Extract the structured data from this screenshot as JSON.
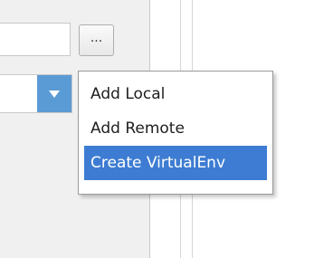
{
  "browse_button": {
    "label": "..."
  },
  "popup_menu": {
    "items": [
      {
        "label": "Add Local",
        "selected": false
      },
      {
        "label": "Add Remote",
        "selected": false
      },
      {
        "label": "Create VirtualEnv",
        "selected": true
      }
    ]
  },
  "colors": {
    "selection": "#3d7cd2",
    "combo_arrow": "#5b9bd5",
    "panel_bg": "#f0f0f0",
    "content_bg": "#ffffff"
  }
}
